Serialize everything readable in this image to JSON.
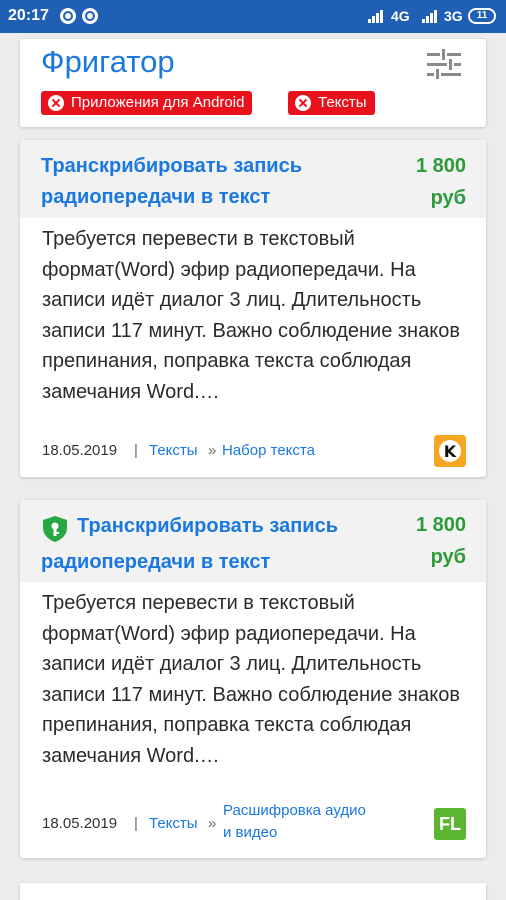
{
  "status_bar": {
    "time": "20:17",
    "network_1": "4G",
    "network_2": "3G",
    "battery": "11"
  },
  "header": {
    "title": "Фригатор",
    "filters": [
      "Приложения для Android",
      "Тексты"
    ]
  },
  "cards": [
    {
      "title_line1": "Транскрибировать запись",
      "title_line2": "радиопередачи в текст",
      "price_amount": "1 800",
      "price_currency": "руб",
      "description": "Требуется перевести в текстовый формат(Word) эфир радиопередачи. На записи идёт диалог 3 лиц. Длительность записи 117 минут. Важно соблюдение знаков препинания, поправка текста соблюдая замечания Word.…",
      "date": "18.05.2019",
      "category": "Тексты",
      "subcategory": "Набор текста",
      "source_icon": "kwork-icon",
      "verified": false
    },
    {
      "title_line1": "Транскрибировать запись",
      "title_line2": "радиопередачи в текст",
      "price_amount": "1 800",
      "price_currency": "руб",
      "description": "Требуется перевести в текстовый формат(Word) эфир радиопередачи. На записи идёт диалог 3 лиц. Длительность записи 117 минут.  Важно соблюдение знаков препинания, поправка текста соблюдая замечания Word.…",
      "date": "18.05.2019",
      "category": "Тексты",
      "subcategory_line1": "Расшифровка аудио",
      "subcategory_line2": "и видео",
      "source_icon": "fl-icon",
      "source_label": "FL",
      "verified": true
    }
  ],
  "colors": {
    "status_bar": "#1f60b5",
    "accent_blue": "#1a78e0",
    "price_green": "#2e9b3a",
    "chip_red": "#e8121d"
  }
}
